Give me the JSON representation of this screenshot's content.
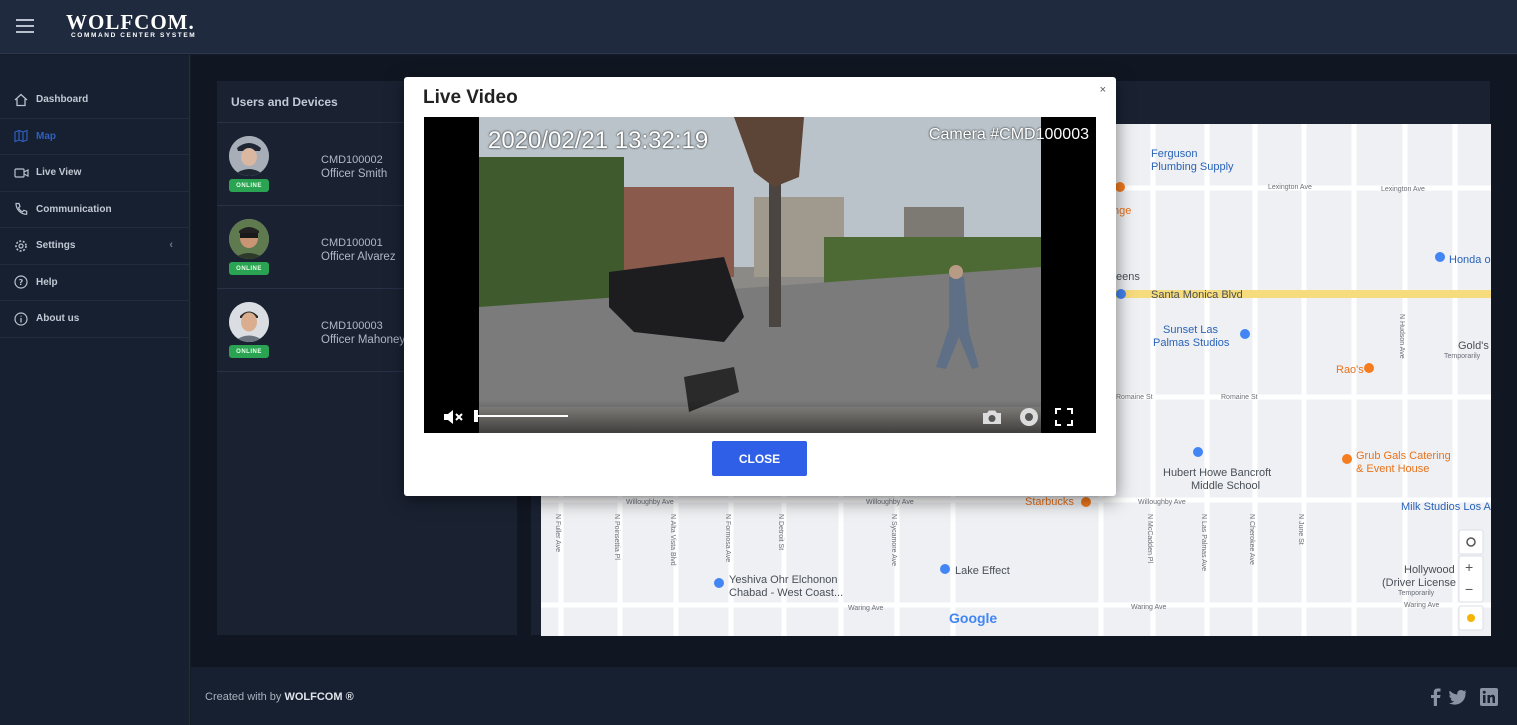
{
  "brand": {
    "name": "WOLFCOM.",
    "subtitle": "COMMAND CENTER SYSTEM"
  },
  "sidebar": {
    "items": [
      {
        "label": "Dashboard",
        "icon": "home-icon"
      },
      {
        "label": "Map",
        "icon": "map-icon",
        "active": true
      },
      {
        "label": "Live View",
        "icon": "video-icon"
      },
      {
        "label": "Communication",
        "icon": "phone-icon"
      },
      {
        "label": "Settings",
        "icon": "gear-icon"
      },
      {
        "label": "Help",
        "icon": "help-icon"
      },
      {
        "label": "About us",
        "icon": "info-icon"
      }
    ]
  },
  "users_panel": {
    "title": "Users and Devices",
    "users": [
      {
        "id": "CMD100002",
        "name": "Officer Smith",
        "status": "ONLINE"
      },
      {
        "id": "CMD100001",
        "name": "Officer Alvarez",
        "status": "ONLINE"
      },
      {
        "id": "CMD100003",
        "name": "Officer Mahoney",
        "status": "ONLINE"
      }
    ]
  },
  "modal": {
    "title": "Live Video",
    "close_x": "×",
    "timestamp": "2020/02/21 13:32:19",
    "camera": "Camera #CMD100003",
    "close_label": "CLOSE",
    "volume_level": 0
  },
  "map": {
    "labels": {
      "ferguson": "Ferguson",
      "plumbing": "Plumbing Supply",
      "lexington1": "Lexington Ave",
      "lexington2": "Lexington Ave",
      "santa_monica": "Santa Monica Blvd",
      "honda": "Honda o",
      "sunset1": "Sunset Las",
      "sunset2": "Palmas Studios",
      "golds1": "Gold's",
      "golds2": "Temporarily",
      "raos": "Rao's",
      "romaine1": "Romaine St",
      "romaine2": "Romaine St",
      "grub1": "Grub Gals Catering",
      "grub2": "& Event House",
      "bancroft1": "Hubert Howe Bancroft",
      "bancroft2": "Middle School",
      "willoughby1": "Willoughby Ave",
      "willoughby2": "Willoughby Ave",
      "willoughby3": "Willoughby Ave",
      "starbucks": "Starbucks",
      "milk": "Milk Studios Los A",
      "yeshiva1": "Yeshiva Ohr Elchonon",
      "yeshiva2": "Chabad - West Coast...",
      "lake": "Lake Effect",
      "hollywood1": "Hollywood",
      "hollywood2": "(Driver License",
      "hollywood3": "Temporarily",
      "waring1": "Waring Ave",
      "waring2": "Waring Ave",
      "waring3": "Waring Ave",
      "eens": "eens",
      "nge": "nge",
      "google": "Google",
      "fuller": "N Fuller Ave",
      "poinsettia": "N Poinsettia Pl",
      "altavista": "N Alta Vista Blvd",
      "formosa": "N Formosa Ave",
      "detroit": "N Detroit St",
      "sycamore": "N Sycamore Ave",
      "mccadden": "N McCadden Pl",
      "laspalmas": "N Las Palmas Ave",
      "cherokee": "N Cherokee Ave",
      "june": "N June St",
      "hudson": "N Hudson Ave"
    },
    "zoom_in": "+",
    "zoom_out": "−"
  },
  "footer": {
    "prefix": "Created with by ",
    "brand": "WOLFCOM ®"
  },
  "colors": {
    "accent": "#2f5fe6",
    "online": "#2aa452",
    "topbar": "#1f2a3e"
  }
}
